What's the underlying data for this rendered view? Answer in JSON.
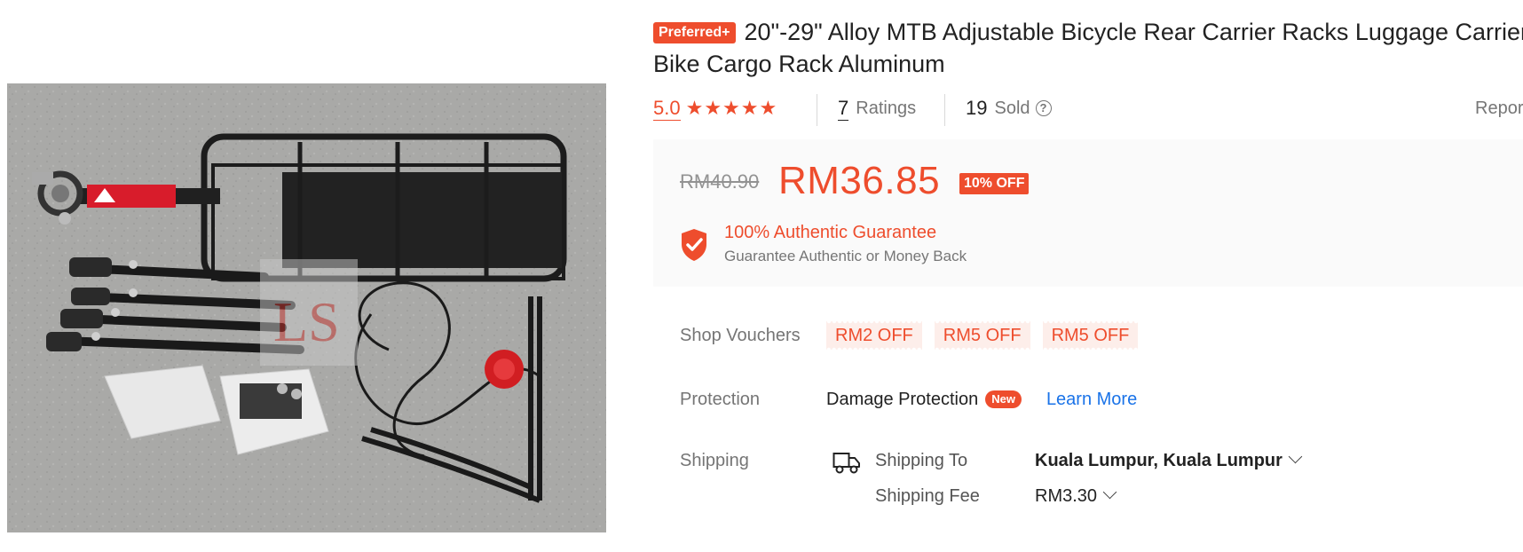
{
  "product": {
    "badge": "Preferred+",
    "title": "20\"-29\" Alloy MTB Adjustable Bicycle Rear Carrier Racks Luggage Carrier Bike Cargo Rack Aluminum",
    "image_watermark": "LS"
  },
  "stats": {
    "rating": "5.0",
    "stars": "★★★★★",
    "rating_stars": 5,
    "ratings_count": "7",
    "ratings_label": "Ratings",
    "sold_count": "19",
    "sold_label": "Sold",
    "help_icon": "?",
    "report": "Report"
  },
  "price": {
    "original": "RM40.90",
    "current": "RM36.85",
    "discount": "10% OFF"
  },
  "guarantee": {
    "title": "100% Authentic Guarantee",
    "subtitle": "Guarantee Authentic or Money Back"
  },
  "vouchers": {
    "label": "Shop Vouchers",
    "items": [
      "RM2 OFF",
      "RM5 OFF",
      "RM5 OFF"
    ]
  },
  "protection": {
    "label": "Protection",
    "name": "Damage Protection",
    "badge": "New",
    "link": "Learn More"
  },
  "shipping": {
    "label": "Shipping",
    "to_label": "Shipping To",
    "to_value": "Kuala Lumpur, Kuala Lumpur",
    "fee_label": "Shipping Fee",
    "fee_value": "RM3.30"
  },
  "colors": {
    "accent": "#ee4d2d",
    "link": "#1a73e8",
    "price_bg": "#fafafa",
    "voucher_bg": "#fdeeea"
  }
}
